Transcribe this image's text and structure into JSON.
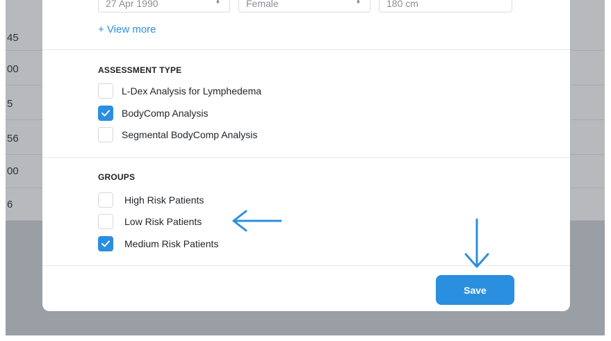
{
  "background_table": {
    "rows": [
      {
        "value": "45"
      },
      {
        "value": "00"
      },
      {
        "value": "5"
      },
      {
        "value": "56"
      },
      {
        "value": "00"
      },
      {
        "value": "6"
      }
    ]
  },
  "modal": {
    "profile_fields": {
      "date_of_birth": "27 Apr 1990",
      "sex": "Female",
      "height": "180 cm"
    },
    "view_more_label": "+ View more",
    "assessment_type": {
      "title": "ASSESSMENT TYPE",
      "options": [
        {
          "label": "L-Dex Analysis for Lymphedema",
          "checked": false
        },
        {
          "label": "BodyComp Analysis",
          "checked": true
        },
        {
          "label": "Segmental BodyComp Analysis",
          "checked": false
        }
      ]
    },
    "groups": {
      "title": "GROUPS",
      "options": [
        {
          "label": "High Risk Patients",
          "checked": false
        },
        {
          "label": "Low Risk Patients",
          "checked": false
        },
        {
          "label": "Medium Risk Patients",
          "checked": true
        }
      ]
    },
    "save_label": "Save"
  },
  "colors": {
    "accent": "#2b8fe0",
    "overlay": "#9a9ea5",
    "modal_bg": "#ffffff"
  }
}
